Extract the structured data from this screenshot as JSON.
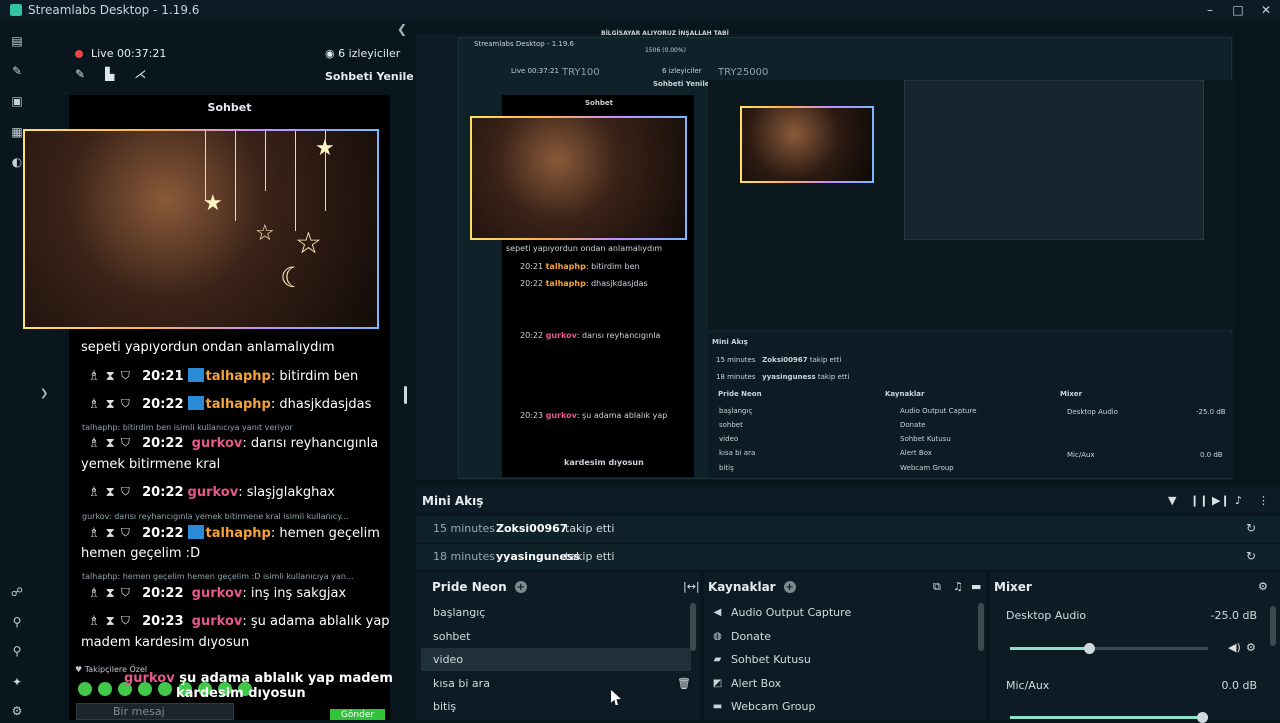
{
  "window": {
    "title": "Streamlabs Desktop - 1.19.6",
    "controls": [
      "–",
      "□",
      "✕"
    ]
  },
  "nav": {
    "icons": [
      "editor-icon",
      "themes-icon",
      "studio-icon",
      "layout-icon",
      "chat-icon",
      "discord-icon",
      "link-icon",
      "share-icon",
      "effects-icon",
      "settings-icon"
    ]
  },
  "chat": {
    "live_label": "Live 00:37:21",
    "viewers": "6 izleyiciler",
    "refresh": "Sohbeti Yenile",
    "header": "Sohbet",
    "partial_line": "sepeti yapıyordun ondan anlamalıydım",
    "messages": [
      {
        "time": "20:21",
        "user": "talhaphp",
        "text": ": bitirdim ben"
      },
      {
        "time": "20:22",
        "user": "talhaphp",
        "text": ": dhasjkdasjdas"
      }
    ],
    "sys1": "talhaphp: bitirdim ben isimli kullanıcıya yanıt veriyor",
    "m3": {
      "time": "20:22",
      "user": "gurkov",
      "text": ": darısı reyhancıgınla",
      "cont": "yemek bitirmene kral"
    },
    "m4": {
      "time": "20:22",
      "user": "gurkov",
      "text": ": slaşjglakghax"
    },
    "sys2": "gurkov: darısı reyhancıgınla yemek bitirmene kral isimli kullanıcy...",
    "m5": {
      "time": "20:22",
      "user": "talhaphp",
      "text": ": hemen geçelim",
      "cont": "hemen geçelim :D"
    },
    "sys3": "talhaphp: hemen geçelim hemen geçelim :D isimli kullanıcıya yan...",
    "m6": {
      "time": "20:22",
      "user": "gurkov",
      "text": ": inş inş sakgjax"
    },
    "m7": {
      "time": "20:23",
      "user": "gurkov",
      "text": ": şu adama ablalık yap",
      "cont": "madem kardesim dıyosun"
    },
    "followers": "Takipçilere Özel",
    "overlay_user": "gurkov",
    "overlay_line1": " şu adama ablalık yap madem",
    "overlay_line2": "kardesim dıyosun",
    "input_placeholder": "Bir mesaj",
    "send": "Gönder"
  },
  "preview": {
    "inner_title": "Streamlabs Desktop - 1.19.6",
    "top_banner": "BİLGİSAYAR ALIYORUZ İNŞALLAH TABİ",
    "top_stat": "1506 (0.00%)",
    "try1": "TRY100",
    "try2": "TRY25000",
    "live": "Live 00:37:21",
    "viewers": "6 izleyiciler",
    "refresh": "Sohbeti Yenile",
    "header": "Sohbet",
    "mini_title": "Mini Akış",
    "ev1_ago": "15 minutes",
    "ev1_who": "Zoksi00967",
    "ev1_act": "takip etti",
    "ev2_ago": "18 minutes",
    "ev2_who": "yyasinguness",
    "ev2_act": "takip etti",
    "scenes_title": "Pride Neon",
    "sources_title": "Kaynaklar",
    "mixer_title": "Mixer",
    "scenes": [
      "başlangıç",
      "sohbet",
      "video",
      "kısa bi ara",
      "bitiş"
    ],
    "sources": [
      "Audio Output Capture",
      "Donate",
      "Sohbet Kutusu",
      "Alert Box",
      "Webcam Group"
    ],
    "desktop_audio": "Desktop Audio",
    "desktop_db": "-25.0 dB",
    "mic": "Mic/Aux",
    "mic_db": "0.0 dB"
  },
  "minifeed": {
    "title": "Mini Akış",
    "events": [
      {
        "ago": "15 minutes",
        "who": "Zoksi00967",
        "action": "takip etti"
      },
      {
        "ago": "18 minutes",
        "who": "yyasinguness",
        "action": "takip etti"
      }
    ]
  },
  "scenes": {
    "title": "Pride Neon",
    "items": [
      "başlangıç",
      "sohbet",
      "video",
      "kısa bi ara",
      "bitiş"
    ],
    "active": "video"
  },
  "sources": {
    "title": "Kaynaklar",
    "items": [
      "Audio Output Capture",
      "Donate",
      "Sohbet Kutusu",
      "Alert Box",
      "Webcam Group"
    ]
  },
  "mixer": {
    "title": "Mixer",
    "channels": [
      {
        "name": "Desktop Audio",
        "db": "-25.0 dB",
        "level": 0.4
      },
      {
        "name": "Mic/Aux",
        "db": "0.0 dB",
        "level": 1.0
      }
    ]
  },
  "colors": {
    "accent": "#31c3a2",
    "highlight_user": "#f4a23a",
    "pink_user": "#e5598a",
    "send": "#31c33a"
  }
}
